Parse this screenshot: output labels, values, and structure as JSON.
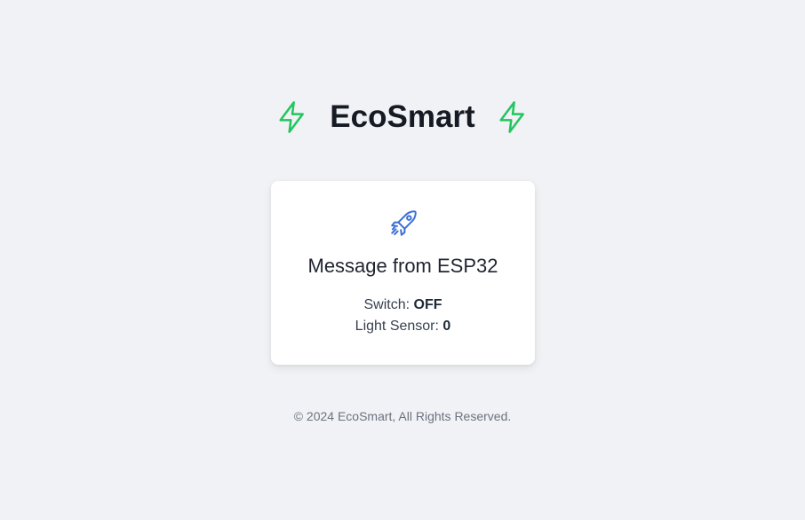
{
  "header": {
    "brand": "EcoSmart",
    "left_icon": "lightning-bolt-icon",
    "right_icon": "lightning-bolt-icon",
    "accent_color": "#22c55e"
  },
  "card": {
    "icon": "rocket-icon",
    "icon_color": "#3b6fd8",
    "title": "Message from ESP32",
    "switch_label": "Switch:",
    "switch_value": "OFF",
    "light_label": "Light Sensor:",
    "light_value": "0"
  },
  "footer": {
    "text": "© 2024 EcoSmart, All Rights Reserved."
  }
}
